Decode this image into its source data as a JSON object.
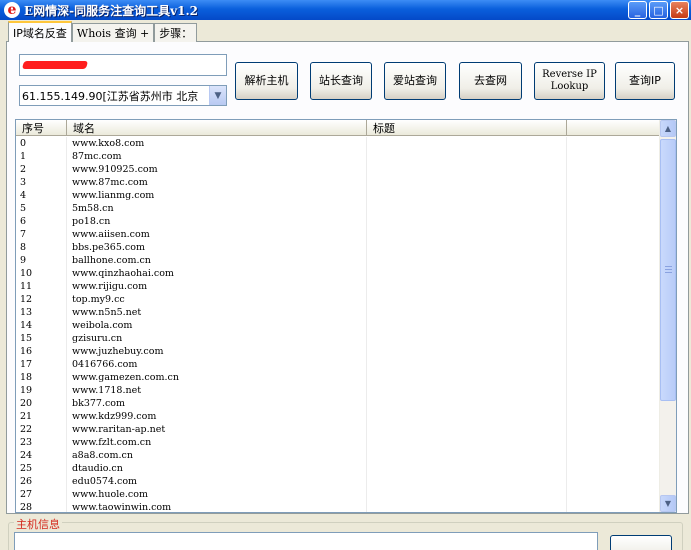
{
  "window": {
    "title": "E网情深-同服务注查询工具v1.2",
    "icon_letter": "e",
    "minimize_glyph": "_",
    "maximize_glyph": "□",
    "close_glyph": "×"
  },
  "tabs": [
    {
      "label": "IP域名反查",
      "active": true
    },
    {
      "label": "Whois 查询 +",
      "active": false
    },
    {
      "label": "步骤：",
      "active": false
    }
  ],
  "host_input": {
    "value": ""
  },
  "ip_select": {
    "value": "61.155.149.90[江苏省苏州市 北京"
  },
  "buttons": {
    "resolve": "解析主机",
    "chinaz": "站长查询",
    "aizhan": "爱站查询",
    "qucha": "去查网",
    "reverse_ip_line1": "Reverse IP",
    "reverse_ip_line2": "Lookup",
    "query_ip": "查询IP"
  },
  "list": {
    "columns": [
      "序号",
      "域名",
      "标题",
      ""
    ],
    "rows": [
      [
        "0",
        "www.kxo8.com"
      ],
      [
        "1",
        "87mc.com"
      ],
      [
        "2",
        "www.910925.com"
      ],
      [
        "3",
        "www.87mc.com"
      ],
      [
        "4",
        "www.lianmg.com"
      ],
      [
        "5",
        "5m58.cn"
      ],
      [
        "6",
        "po18.cn"
      ],
      [
        "7",
        "www.aiisen.com"
      ],
      [
        "8",
        "bbs.pe365.com"
      ],
      [
        "9",
        "ballhone.com.cn"
      ],
      [
        "10",
        "www.qinzhaohai.com"
      ],
      [
        "11",
        "www.rijigu.com"
      ],
      [
        "12",
        "top.my9.cc"
      ],
      [
        "13",
        "www.n5n5.net"
      ],
      [
        "14",
        "weibola.com"
      ],
      [
        "15",
        "gzisuru.cn"
      ],
      [
        "16",
        "www.juzhebuy.com"
      ],
      [
        "17",
        "0416766.com"
      ],
      [
        "18",
        "www.gamezen.com.cn"
      ],
      [
        "19",
        "www.1718.net"
      ],
      [
        "20",
        "bk377.com"
      ],
      [
        "21",
        "www.kdz999.com"
      ],
      [
        "22",
        "www.raritan-ap.net"
      ],
      [
        "23",
        "www.fzlt.com.cn"
      ],
      [
        "24",
        "a8a8.com.cn"
      ],
      [
        "25",
        "dtaudio.cn"
      ],
      [
        "26",
        "edu0574.com"
      ],
      [
        "27",
        "www.huole.com"
      ],
      [
        "28",
        "www.taowinwin.com"
      ]
    ]
  },
  "host_info": {
    "label": "主机信息"
  },
  "scrollbar": {
    "up_glyph": "▲",
    "down_glyph": "▼",
    "dropdown_glyph": "▼"
  },
  "colors": {
    "title_bar": "#0a5fdc",
    "host_info_label": "#d4281c",
    "redaction": "#ff1e1e"
  }
}
